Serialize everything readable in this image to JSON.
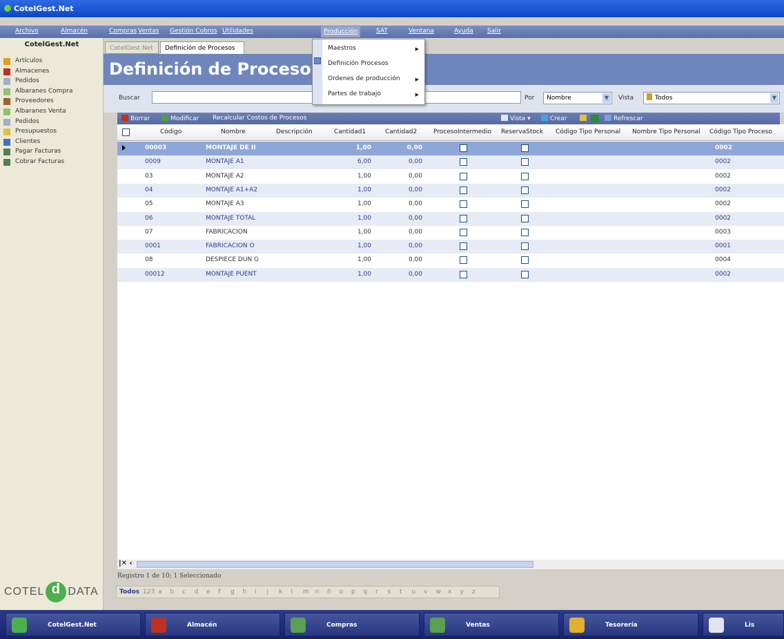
{
  "window": {
    "title": "CotelGest.Net"
  },
  "menu": [
    {
      "label": "Archivo",
      "x": 1
    },
    {
      "label": "Almacén",
      "x": 2
    },
    {
      "label": "Compras",
      "x": 3
    },
    {
      "label": "Ventas",
      "x": 4
    },
    {
      "label": "Gestión Cobros",
      "x": 5
    },
    {
      "label": "Utilidades",
      "x": 6
    },
    {
      "label": "Producción",
      "x": 7
    },
    {
      "label": "SAT",
      "x": 8
    },
    {
      "label": "Ventana",
      "x": 9
    },
    {
      "label": "Ayuda",
      "x": 10
    },
    {
      "label": "Salir",
      "x": 11
    }
  ],
  "sidebar": {
    "header": "CotelGest.Net",
    "items": [
      {
        "label": "Artículos",
        "color": "#e0a020"
      },
      {
        "label": "Almacenes",
        "color": "#c03020"
      },
      {
        "label": "Pedidos",
        "color": "#a0b0c8"
      },
      {
        "label": "Albaranes Compra",
        "color": "#90c070"
      },
      {
        "label": "Proveedores",
        "color": "#a06030"
      },
      {
        "label": "Albaranes Venta",
        "color": "#90c070"
      },
      {
        "label": "Pedidos",
        "color": "#a0b0c8"
      },
      {
        "label": "Presupuestos",
        "color": "#e0c040"
      },
      {
        "label": "Clientes",
        "color": "#4070c0"
      },
      {
        "label": "Pagar Facturas",
        "color": "#508050"
      },
      {
        "label": "Cobrar Facturas",
        "color": "#508050"
      }
    ],
    "logo_left": "COTEL",
    "logo_mid": "d",
    "logo_right": "DATA"
  },
  "tabs": [
    {
      "label": "CotelGest.Net",
      "active": false
    },
    {
      "label": "Definición de Procesos",
      "active": true
    }
  ],
  "page": {
    "title": "Definición de Procesos"
  },
  "search": {
    "label": "Buscar",
    "value": "",
    "por_label": "Por",
    "por_value": "Nombre",
    "vista_label": "Vista",
    "vista_value": "Todos"
  },
  "toolbar": {
    "borrar": "Borrar",
    "modificar": "Modificar",
    "recalcular": "Recalcular Costos de Procesos",
    "vista": "Vista",
    "crear": "Crear",
    "refrescar": "Refrescar"
  },
  "grid": {
    "columns": [
      "Código",
      "Nombre",
      "Descripción",
      "Cantidad1",
      "Cantidad2",
      "ProcesoIntermedio",
      "ReservaStock",
      "Código Tipo Personal",
      "Nombre Tipo Personal",
      "Código Tipo Proceso"
    ],
    "rows": [
      {
        "codigo": "00003",
        "nombre": "MONTAJE DE II",
        "descripcion": "",
        "cant1": "1,00",
        "cant2": "0,00",
        "tipo_proceso": "0002"
      },
      {
        "codigo": "0009",
        "nombre": "MONTAJE A1",
        "descripcion": "",
        "cant1": "6,00",
        "cant2": "0,00",
        "tipo_proceso": "0002"
      },
      {
        "codigo": "03",
        "nombre": "MONTAJE A2",
        "descripcion": "",
        "cant1": "1,00",
        "cant2": "0,00",
        "tipo_proceso": "0002"
      },
      {
        "codigo": "04",
        "nombre": "MONTAJE A1+A2",
        "descripcion": "",
        "cant1": "1,00",
        "cant2": "0,00",
        "tipo_proceso": "0002"
      },
      {
        "codigo": "05",
        "nombre": "MONTAJE A3",
        "descripcion": "",
        "cant1": "1,00",
        "cant2": "0,00",
        "tipo_proceso": "0002"
      },
      {
        "codigo": "06",
        "nombre": "MONTAJE TOTAL",
        "descripcion": "",
        "cant1": "1,00",
        "cant2": "0,00",
        "tipo_proceso": "0002"
      },
      {
        "codigo": "07",
        "nombre": "FABRICACION",
        "descripcion": "",
        "cant1": "1,00",
        "cant2": "0,00",
        "tipo_proceso": "0003"
      },
      {
        "codigo": "0001",
        "nombre": "FABRICACION O",
        "descripcion": "",
        "cant1": "1,00",
        "cant2": "0,00",
        "tipo_proceso": "0001"
      },
      {
        "codigo": "08",
        "nombre": "DESPIECE DUN G",
        "descripcion": "",
        "cant1": "1,00",
        "cant2": "0,00",
        "tipo_proceso": "0004"
      },
      {
        "codigo": "00012",
        "nombre": "MONTAJE PUENT",
        "descripcion": "",
        "cant1": "1,00",
        "cant2": "0,00",
        "tipo_proceso": "0002"
      }
    ]
  },
  "status": {
    "text": "Registro 1 de 10; 1 Seleccionado"
  },
  "alphabet": [
    "Todos",
    "123",
    "a",
    "b",
    "c",
    "d",
    "e",
    "f",
    "g",
    "h",
    "i",
    "j",
    "k",
    "l",
    "m",
    "n",
    "ñ",
    "o",
    "p",
    "q",
    "r",
    "s",
    "t",
    "u",
    "v",
    "w",
    "x",
    "y",
    "z"
  ],
  "produccion_menu": [
    {
      "label": "Maestros",
      "arrow": true
    },
    {
      "label": "Definición Procesos",
      "arrow": false
    },
    {
      "label": "Ordenes de producción",
      "arrow": true
    },
    {
      "label": "Partes de trabajo",
      "arrow": true
    }
  ],
  "taskbar": [
    {
      "label": "CotelGest.Net",
      "color": "#4caf50"
    },
    {
      "label": "Almacén",
      "color": "#c03020"
    },
    {
      "label": "Compras",
      "color": "#5aa050"
    },
    {
      "label": "Ventas",
      "color": "#5aa050"
    },
    {
      "label": "Tesorería",
      "color": "#e0b030"
    },
    {
      "label": "Lis",
      "color": "#e0e4ee"
    }
  ]
}
